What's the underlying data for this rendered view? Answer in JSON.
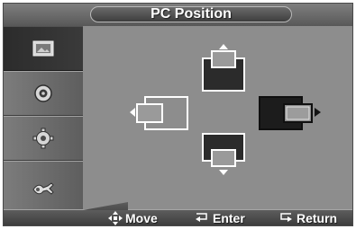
{
  "title": "PC Position",
  "sidebar": {
    "items": [
      {
        "icon": "picture-icon",
        "active": true
      },
      {
        "icon": "sound-icon",
        "active": false
      },
      {
        "icon": "setup-icon",
        "active": false
      },
      {
        "icon": "input-icon",
        "active": false
      }
    ]
  },
  "positions": {
    "up": {
      "icon": "position-up-icon",
      "selected": false
    },
    "left": {
      "icon": "position-left-icon",
      "selected": false
    },
    "right": {
      "icon": "position-right-icon",
      "selected": true
    },
    "down": {
      "icon": "position-down-icon",
      "selected": false
    }
  },
  "footer": {
    "move_label": "Move",
    "enter_label": "Enter",
    "return_label": "Return",
    "move_icon": "move-arrows-icon",
    "enter_icon": "enter-icon",
    "return_icon": "return-icon"
  }
}
